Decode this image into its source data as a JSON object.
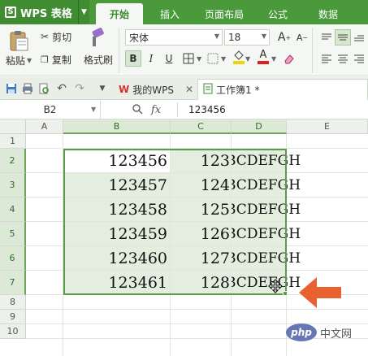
{
  "app": {
    "title": "WPS 表格"
  },
  "ribbon_tabs": [
    "开始",
    "插入",
    "页面布局",
    "公式",
    "数据"
  ],
  "ribbon": {
    "paste_label": "粘贴",
    "cut_label": "剪切",
    "copy_label": "复制",
    "format_painter_label": "格式刷",
    "font_name": "宋体",
    "font_size": "18",
    "bold": "B",
    "italic": "I",
    "underline": "U",
    "increase_font": "A",
    "decrease_font": "A",
    "font_color_glyph": "A"
  },
  "document_tabs": [
    {
      "label": "我的WPS",
      "active": false
    },
    {
      "label": "工作簿1 *",
      "active": true
    }
  ],
  "formula_bar": {
    "name_box": "B2",
    "fx": "fx",
    "value": "123456"
  },
  "columns": [
    "A",
    "B",
    "C",
    "D",
    "E"
  ],
  "rows": [
    "1",
    "2",
    "3",
    "4",
    "5",
    "6",
    "7",
    "8",
    "9",
    "10"
  ],
  "cells": [
    {
      "row": "2",
      "b": "123456",
      "c": "123",
      "d": "BCDEFGH"
    },
    {
      "row": "3",
      "b": "123457",
      "c": "124",
      "d": "BCDEFGH"
    },
    {
      "row": "4",
      "b": "123458",
      "c": "125",
      "d": "BCDEFGH"
    },
    {
      "row": "5",
      "b": "123459",
      "c": "126",
      "d": "BCDEFGH"
    },
    {
      "row": "6",
      "b": "123460",
      "c": "127",
      "d": "BCDEFGH"
    },
    {
      "row": "7",
      "b": "123461",
      "c": "128",
      "d": "BCDEFGH"
    }
  ],
  "selection": {
    "range": "B2:D7",
    "accent": "#5c9a4d"
  },
  "annotation_arrow_color": "#e8622f",
  "watermark": {
    "badge": "php",
    "text": "中文网"
  },
  "colors": {
    "brand_green": "#4a9a3c",
    "ribbon_bg": "#f4f7f3",
    "selection_fill": "#e3eedf"
  }
}
